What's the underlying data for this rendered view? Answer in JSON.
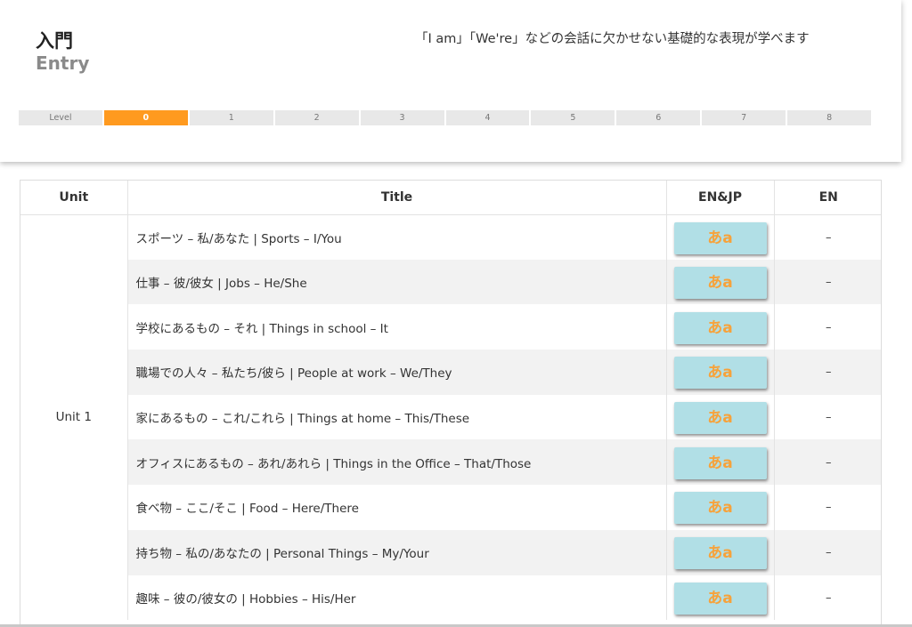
{
  "header": {
    "title_jp": "入門",
    "title_en": "Entry",
    "description": "「I am」「We're」などの会話に欠かせない基礎的な表現が学べます"
  },
  "level_bar": {
    "label": "Level",
    "levels": [
      "0",
      "1",
      "2",
      "3",
      "4",
      "5",
      "6",
      "7",
      "8"
    ],
    "active_level": "0",
    "active_color": "#ff9a1f"
  },
  "table": {
    "headers": {
      "unit": "Unit",
      "title": "Title",
      "enjp": "EN&JP",
      "en": "EN"
    },
    "unit_label": "Unit 1",
    "button_label": "あa",
    "button_color": "#b1dfe6",
    "en_placeholder": "–",
    "rows": [
      {
        "title": "スポーツ – 私/あなた | Sports – I/You"
      },
      {
        "title": "仕事 – 彼/彼女 | Jobs – He/She"
      },
      {
        "title": "学校にあるもの – それ | Things in school – It"
      },
      {
        "title": "職場での人々 – 私たち/彼ら | People at work – We/They"
      },
      {
        "title": "家にあるもの – これ/これら | Things at home – This/These"
      },
      {
        "title": "オフィスにあるもの – あれ/あれら | Things in the Office – That/Those"
      },
      {
        "title": "食べ物 – ここ/そこ | Food – Here/There"
      },
      {
        "title": "持ち物 – 私の/あなたの | Personal Things – My/Your"
      },
      {
        "title": "趣味 – 彼の/彼女の | Hobbies – His/Her"
      }
    ]
  }
}
